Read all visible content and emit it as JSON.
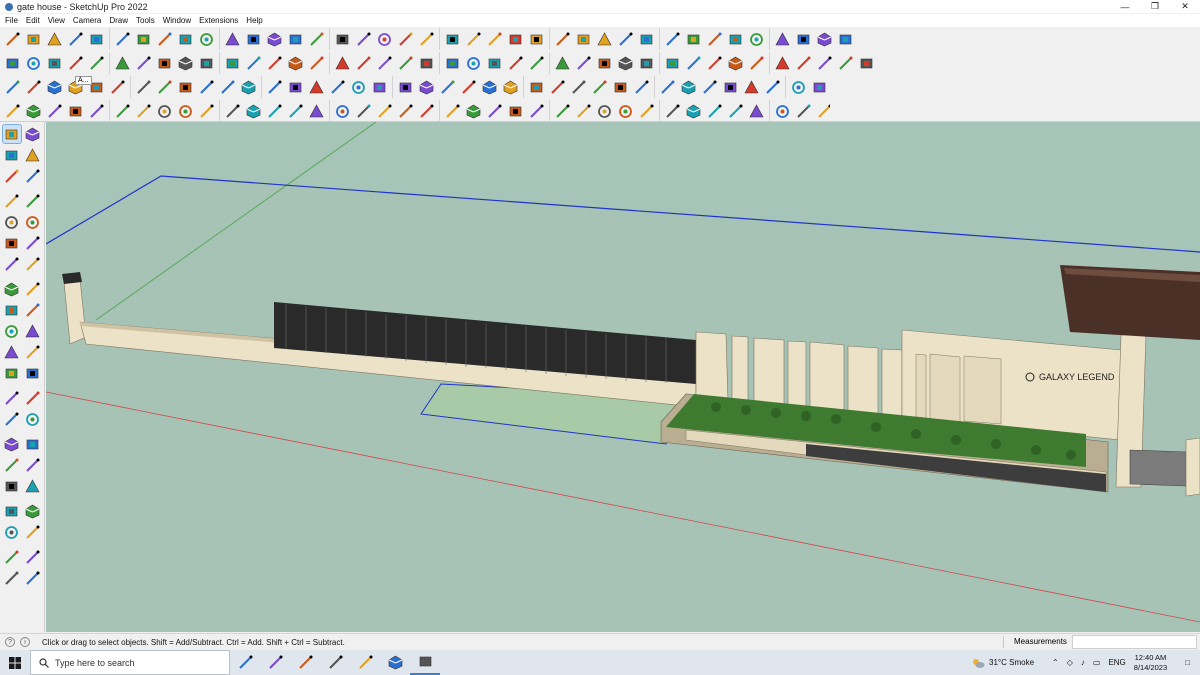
{
  "window": {
    "title": "gate house - SketchUp Pro 2022",
    "controls": [
      "minimize-icon",
      "restore-icon",
      "close-icon"
    ]
  },
  "menu": [
    "File",
    "Edit",
    "View",
    "Camera",
    "Draw",
    "Tools",
    "Window",
    "Extensions",
    "Help"
  ],
  "toolbar": {
    "tooltip_fragment": "A...",
    "rows": [
      [
        "search-icon",
        "select-icon",
        "eraser-icon",
        "pencil-icon",
        "paint-bucket-icon",
        "cube-icon",
        "tape-measure-icon",
        "push-pull-icon",
        "move-icon",
        "rotate-icon",
        "scale-icon",
        "text-icon",
        "orbit-icon",
        "pan-icon",
        "zoom-icon",
        "zoom-extents-icon",
        "layers-icon",
        "styles-icon",
        "components-icon",
        "materials-icon",
        "geo-location-icon",
        "section-plane-icon",
        "undo-icon",
        "redo-icon",
        "export-icon"
      ],
      [
        "iso-view-icon",
        "top-view-icon",
        "front-view-icon",
        "right-view-icon",
        "back-view-icon",
        "left-view-icon",
        "xray-icon",
        "wireframe-icon",
        "hidden-line-icon",
        "shaded-icon",
        "textured-icon",
        "monochrome-icon",
        "edges-icon",
        "house-icon",
        "shadow-icon",
        "fog-icon",
        "dimension-icon",
        "protractor-icon",
        "warehouse-icon",
        "extension-icon"
      ],
      [
        "solid-union-icon",
        "solid-subtract-icon",
        "solid-intersect-icon",
        "solid-trim-icon",
        "solid-split-icon",
        "outer-shell-icon",
        "sandbox-icon",
        "stamp-icon",
        "drape-icon",
        "flip-edge-icon",
        "add-detail-icon",
        "smoove-icon",
        "terrain-icon",
        "contour-icon",
        "grid-icon",
        "mesh-icon",
        "subdivide-icon",
        "bevel-icon",
        "fillet-icon",
        "chamfer-icon"
      ],
      [
        "follow-me-icon",
        "offset-icon",
        "arc-icon",
        "circle-icon",
        "polygon-icon",
        "freehand-icon",
        "line-icon",
        "rectangle-icon",
        "rotated-rect-icon",
        "pie-icon",
        "curve-icon",
        "spline-icon",
        "array-icon",
        "stair-icon",
        "wall-icon",
        "window-tool-icon",
        "door-tool-icon",
        "roof-icon",
        "railing-icon",
        "column-icon"
      ]
    ]
  },
  "left_tools": [
    [
      "select-icon",
      "orbit-icon"
    ],
    [
      "paint-bucket-icon",
      "eraser-icon"
    ],
    [
      "components-icon",
      "pencil-icon"
    ],
    [
      "line-icon",
      "freehand-icon"
    ],
    [
      "rectangle-icon",
      "rotated-rect-icon"
    ],
    [
      "circle-icon",
      "polygon-icon"
    ],
    [
      "arc-icon",
      "pie-icon"
    ],
    [
      "offset-icon",
      "follow-me-icon"
    ],
    [
      "move-icon",
      "push-pull-icon"
    ],
    [
      "rotate-icon",
      "scale-icon"
    ],
    [
      "scale-icon",
      "follow-me-icon"
    ],
    [
      "tape-measure-icon",
      "text-icon"
    ],
    [
      "protractor-icon",
      "dimension-icon"
    ],
    [
      "axes-icon",
      "3d-text-icon"
    ],
    [
      "orbit-icon",
      "pan-icon"
    ],
    [
      "zoom-icon",
      "zoom-window-icon"
    ],
    [
      "zoom-extents-icon",
      "zoom-previous-icon"
    ],
    [
      "walk-icon",
      "look-around-icon"
    ],
    [
      "position-camera-icon",
      "section-plane-icon"
    ],
    [
      "warehouse-icon",
      "layers-icon"
    ],
    [
      "sandbox-icon",
      "terrain-icon"
    ]
  ],
  "scene": {
    "signage_text": "GALAXY LEGEND",
    "colors": {
      "sky": "#a6c4b7",
      "ground": "#a8c2a8",
      "wall": "#ece2c8",
      "wall_shadow": "#cfc3a4",
      "fence": "#2a2a2a",
      "plants": "#3e7a2f",
      "roof": "#4a3026",
      "axis_blue": "#2033c8",
      "axis_red": "#d04848",
      "axis_green": "#58a858"
    }
  },
  "status": {
    "hint": "Click or drag to select objects. Shift = Add/Subtract. Ctrl = Add. Shift + Ctrl = Subtract.",
    "measurements_label": "Measurements",
    "measurements_value": ""
  },
  "taskbar": {
    "search_placeholder": "Type here to search",
    "apps": [
      "task-view-icon",
      "calculator-icon",
      "file-explorer-icon",
      "autocad-icon",
      "sketchup-folder-icon",
      "edge-icon",
      "sketchup-icon"
    ],
    "weather": "31°C Smoke",
    "language": "ENG",
    "time": "12:40 AM",
    "date": "8/14/2023"
  }
}
